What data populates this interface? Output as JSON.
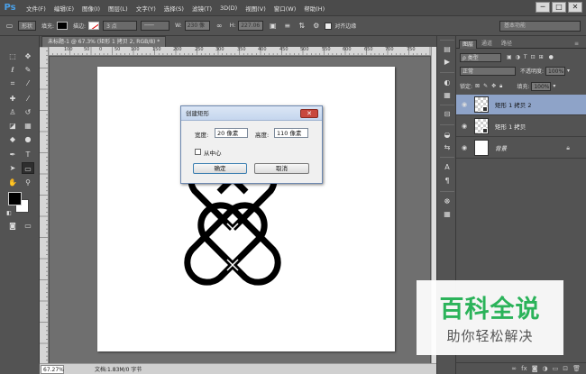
{
  "app": {
    "logo": "Ps"
  },
  "menu": [
    "文件(F)",
    "编辑(E)",
    "图像(I)",
    "图层(L)",
    "文字(Y)",
    "选择(S)",
    "滤镜(T)",
    "3D(D)",
    "视图(V)",
    "窗口(W)",
    "帮助(H)"
  ],
  "window_buttons": {
    "minimize": "─",
    "maximize": "□",
    "close": "✕"
  },
  "options": {
    "mode": "形状",
    "fill_label": "填充:",
    "stroke_label": "描边:",
    "stroke_width": "3 点",
    "w_label": "W:",
    "w_value": "230 像",
    "h_label": "H:",
    "h_value": "227.06",
    "align_edges": "对齐边缘",
    "workspace": "基本功能"
  },
  "document": {
    "tab": "未标题-1 @ 67.3% (矩形 1 拷贝 2, RGB/8) *",
    "ruler_ticks": [
      "100",
      "50",
      "0",
      "50",
      "100",
      "150",
      "200",
      "250",
      "300",
      "350",
      "400",
      "450",
      "500",
      "550",
      "600",
      "650",
      "700",
      "750"
    ]
  },
  "status": {
    "zoom": "67.27%",
    "doc_info": "文档:1.83M/0 字节"
  },
  "dialog": {
    "title": "创建矩形",
    "close": "✕",
    "width_label": "宽度:",
    "width_value": "20 像素",
    "height_label": "高度:",
    "height_value": "110 像素",
    "from_center": "从中心",
    "ok": "确定",
    "cancel": "取消"
  },
  "layers_panel": {
    "tabs": [
      "图层",
      "通道",
      "路径"
    ],
    "kind_filter": "ρ 类型",
    "blend_mode": "正常",
    "opacity_label": "不透明度:",
    "opacity_value": "100%",
    "lock_label": "锁定:",
    "fill_label": "填充:",
    "fill_value": "100%",
    "layers": [
      {
        "name": "矩形 1 拷贝 2",
        "visible": true,
        "selected": true
      },
      {
        "name": "矩形 1 拷贝",
        "visible": true,
        "selected": false
      },
      {
        "name": "背景",
        "visible": true,
        "selected": false,
        "locked": true
      }
    ],
    "footer_icons": [
      "link-icon",
      "fx-icon",
      "mask-icon",
      "adjustment-icon",
      "group-icon",
      "new-layer-icon",
      "trash-icon"
    ]
  },
  "watermark": {
    "title": "百科全说",
    "subtitle": "助你轻松解决"
  },
  "colors": {
    "fill": "#000000",
    "accent": "#2bb35a",
    "selected_layer": "#8ea3c8"
  }
}
